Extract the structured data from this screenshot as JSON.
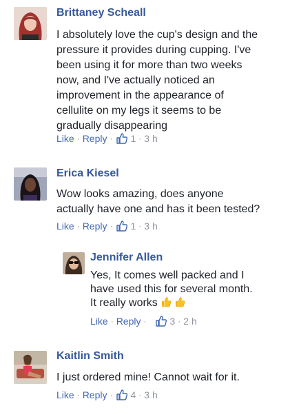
{
  "comments": [
    {
      "name": "Brittaney Scheall",
      "avatar": "woman-red-hair-avatar",
      "lines": [
        "I absolutely love the cup's design and the",
        "pressure it provides during cupping. I've",
        "been using it for more than two weeks",
        "now, and I've actually noticed an",
        "improvement in the appearance of",
        "cellulite on my legs it seems to be",
        "gradually disappearing"
      ],
      "like_label": "Like",
      "reply_label": "Reply",
      "likes": "1",
      "time": "3 h"
    },
    {
      "name": "Erica Kiesel",
      "avatar": "woman-dark-hair-avatar",
      "lines": [
        "Wow looks amazing, does anyone",
        "actually have one and has it been tested?"
      ],
      "like_label": "Like",
      "reply_label": "Reply",
      "likes": "1",
      "time": "3 h"
    },
    {
      "name": "Jennifer Allen",
      "avatar": "woman-sunglasses-avatar",
      "lines": [
        "Yes, It comes well packed and I",
        "have used this for several month.",
        "It really works"
      ],
      "emojis": [
        "thumbs-up-emoji",
        "thumbs-up-emoji"
      ],
      "like_label": "Like",
      "reply_label": "Reply",
      "likes": "3",
      "time": "2 h"
    },
    {
      "name": "Kaitlin Smith",
      "avatar": "woman-sitting-avatar",
      "lines": [
        "I just ordered mine! Cannot wait for it."
      ],
      "like_label": "Like",
      "reply_label": "Reply",
      "likes": "4",
      "time": "3 h"
    }
  ],
  "separator": "·",
  "colors": {
    "name": "#365899",
    "link": "#4267b2",
    "meta": "#90949c",
    "text": "#1d2129"
  }
}
